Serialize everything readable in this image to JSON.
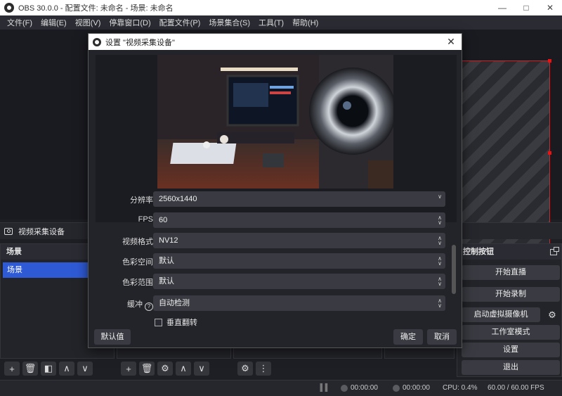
{
  "window": {
    "title": "OBS 30.0.0 - 配置文件: 未命名 - 场景: 未命名"
  },
  "menu": [
    "文件(F)",
    "编辑(E)",
    "视图(V)",
    "停靠窗口(D)",
    "配置文件(P)",
    "场景集合(S)",
    "工具(T)",
    "帮助(H)"
  ],
  "source_bar": {
    "label": "视频采集设备"
  },
  "scenes": {
    "header": "场景",
    "items": [
      "场景"
    ]
  },
  "controls": {
    "header": "控制按钮",
    "buttons": [
      "开始直播",
      "开始录制",
      "启动虚拟摄像机",
      "工作室模式",
      "设置",
      "退出"
    ]
  },
  "status": {
    "stream_time": "00:00:00",
    "rec_time": "00:00:00",
    "cpu": "CPU: 0.4%",
    "fps": "60.00 / 60.00 FPS"
  },
  "dialog": {
    "title": "设置 \"视频采集设备\"",
    "fields": [
      {
        "label": "分辨率",
        "value": "2560x1440"
      },
      {
        "label": "FPS",
        "value": "60"
      },
      {
        "label": "视频格式",
        "value": "NV12"
      },
      {
        "label": "色彩空间",
        "value": "默认"
      },
      {
        "label": "色彩范围",
        "value": "默认"
      },
      {
        "label": "缓冲",
        "value": "自动检测"
      }
    ],
    "checkbox_label": "垂直翻转",
    "defaults_button": "默认值",
    "ok_button": "确定",
    "cancel_button": "取消"
  },
  "colors": {
    "accent": "#2f5ad6",
    "canvas_border": "#d42323",
    "background": "#1e1f25"
  },
  "icons": [
    "camera-icon",
    "plus-icon",
    "trash-icon",
    "filter-icon",
    "up-icon",
    "down-icon",
    "gear-icon",
    "more-icon",
    "close-icon"
  ]
}
